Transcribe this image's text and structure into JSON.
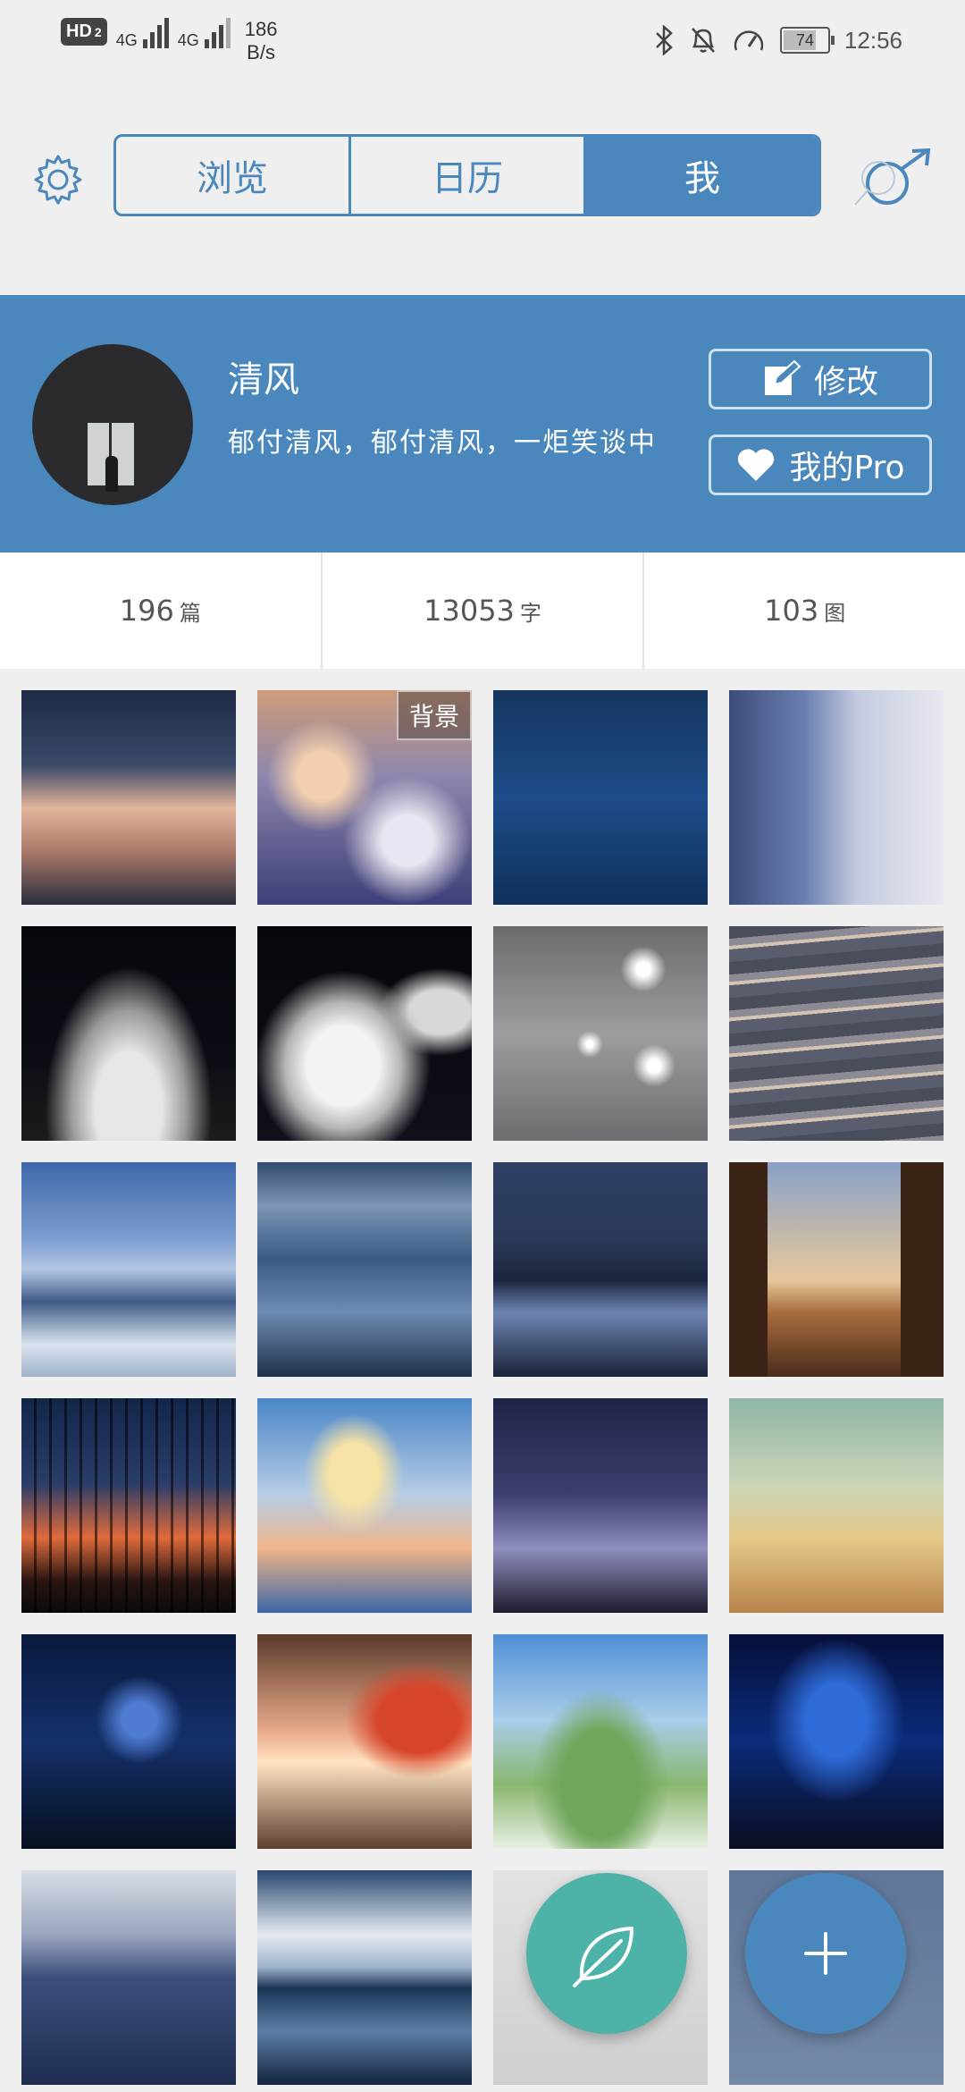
{
  "status": {
    "hd": "HD",
    "hd_sub": "2",
    "net1": "4G",
    "net2": "4G",
    "speed_value": "186",
    "speed_unit": "B/s",
    "battery": "74",
    "time": "12:56"
  },
  "tabs": [
    {
      "label": "浏览",
      "active": false
    },
    {
      "label": "日历",
      "active": false
    },
    {
      "label": "我",
      "active": true
    }
  ],
  "profile": {
    "name": "清风",
    "bio": "郁付清风，郁付清风，一炬笑谈中",
    "edit_label": "修改",
    "pro_label": "我的Pro"
  },
  "stats": [
    {
      "value": "196",
      "unit": "篇"
    },
    {
      "value": "13053",
      "unit": "字"
    },
    {
      "value": "103",
      "unit": "图"
    }
  ],
  "grid": {
    "background_tag": "背景",
    "tiles": [
      {
        "name": "clouds-night-orange"
      },
      {
        "name": "clouds-sea-purple"
      },
      {
        "name": "blue-sea-pole"
      },
      {
        "name": "sky-rotated"
      },
      {
        "name": "comet-clouds-night"
      },
      {
        "name": "moon-clouds-night"
      },
      {
        "name": "water-sparkle-grey"
      },
      {
        "name": "water-ripples"
      },
      {
        "name": "mountain-blue-sky"
      },
      {
        "name": "harbor-boat"
      },
      {
        "name": "night-lake-person"
      },
      {
        "name": "window-balcony-sunset"
      },
      {
        "name": "fence-sunset-girl"
      },
      {
        "name": "sailing-ship-sky"
      },
      {
        "name": "dusk-trees"
      },
      {
        "name": "ruined-greenhouse"
      },
      {
        "name": "night-cathedral-wolves"
      },
      {
        "name": "red-tree-veranda"
      },
      {
        "name": "green-castle"
      },
      {
        "name": "starry-galaxy-city"
      },
      {
        "name": "night-sea-sparkle"
      },
      {
        "name": "clouds-sea-blue"
      },
      {
        "name": "grey-book-cover"
      },
      {
        "name": "blue-book-cover"
      }
    ]
  },
  "colors": {
    "accent": "#4a87bd",
    "leaf_fab": "#4db3a8"
  }
}
